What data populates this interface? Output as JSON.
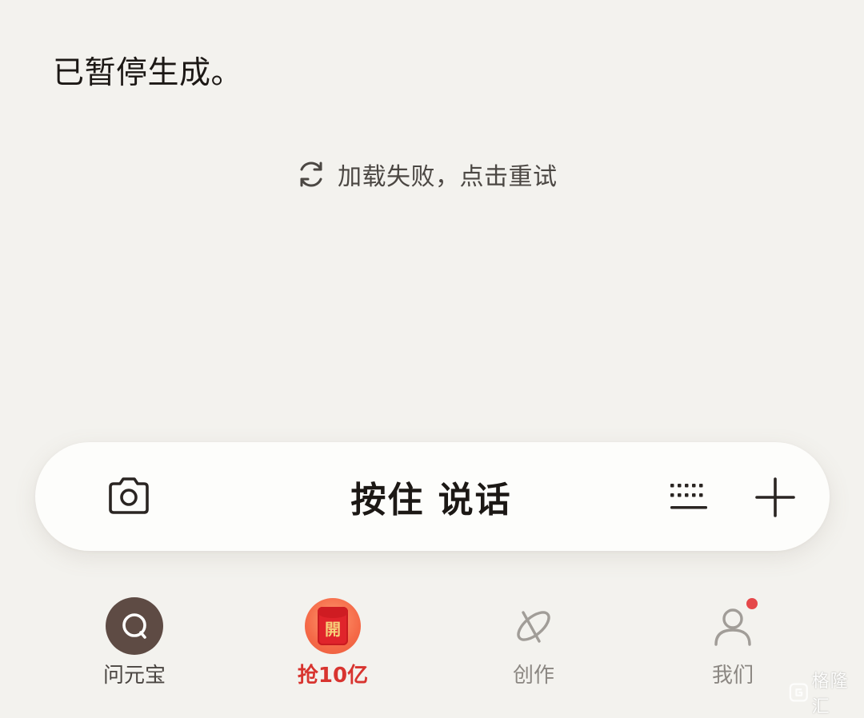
{
  "chat": {
    "paused_message": "已暂停生成。",
    "retry_label": "加载失败，点击重试",
    "retry_icon": "refresh-icon"
  },
  "input_bar": {
    "camera_icon": "camera-icon",
    "hold_to_talk_label": "按住 说话",
    "keyboard_icon": "keyboard-icon",
    "plus_icon": "plus-icon"
  },
  "nav": {
    "items": [
      {
        "label": "问元宝",
        "icon": "chat-bubble-icon",
        "active": true
      },
      {
        "label": "抢10亿",
        "icon": "red-envelope-icon",
        "badge_char": "開"
      },
      {
        "label": "创作",
        "icon": "create-icon"
      },
      {
        "label": "我们",
        "icon": "person-icon",
        "has_notification": true
      }
    ]
  },
  "colors": {
    "background": "#f3f2ee",
    "accent_red": "#d8342f",
    "home_icon_bg": "#5e4b44",
    "notification_dot": "#e5484a"
  },
  "watermark": {
    "text": "格隆汇"
  }
}
